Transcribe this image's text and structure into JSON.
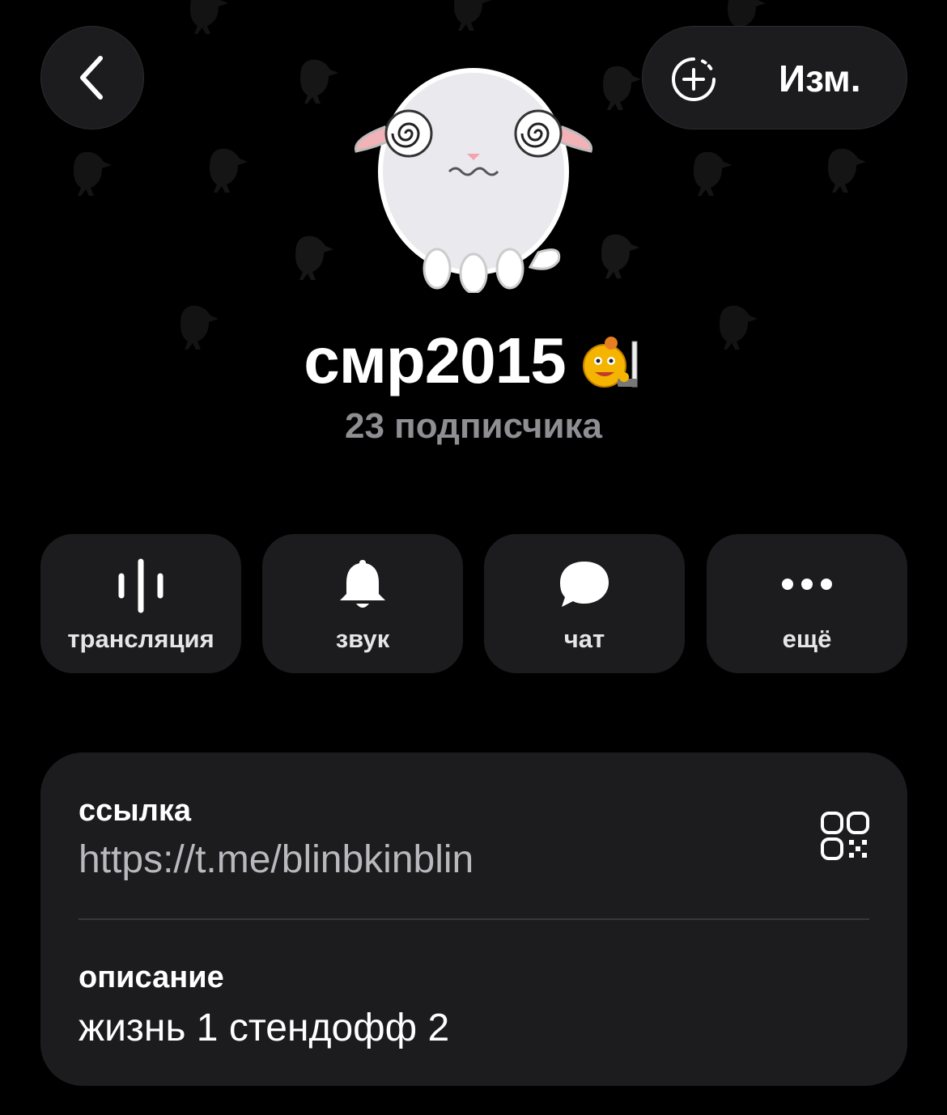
{
  "header": {
    "back_icon": "chevron-left-icon",
    "story_icon": "add-story-icon",
    "edit_label": "Изм."
  },
  "profile": {
    "avatar": "sheep-sticker-avatar",
    "name": "смр2015",
    "name_emoji": "emoji-status-icon",
    "subscribers": "23 подписчика"
  },
  "actions": [
    {
      "label": "трансляция",
      "icon": "live-stream-icon"
    },
    {
      "label": "звук",
      "icon": "bell-icon"
    },
    {
      "label": "чат",
      "icon": "chat-bubble-icon"
    },
    {
      "label": "ещё",
      "icon": "more-dots-icon"
    }
  ],
  "info": {
    "link_label": "ссылка",
    "link_value": "https://t.me/blinbkinblin",
    "qr_icon": "qr-code-icon",
    "description_label": "описание",
    "description_value": "жизнь 1 стендофф 2"
  },
  "colors": {
    "background": "#000000",
    "card": "#1c1c1e",
    "secondary_text": "#8e8e93",
    "link_text": "#b8b8be",
    "separator": "#38383a"
  }
}
